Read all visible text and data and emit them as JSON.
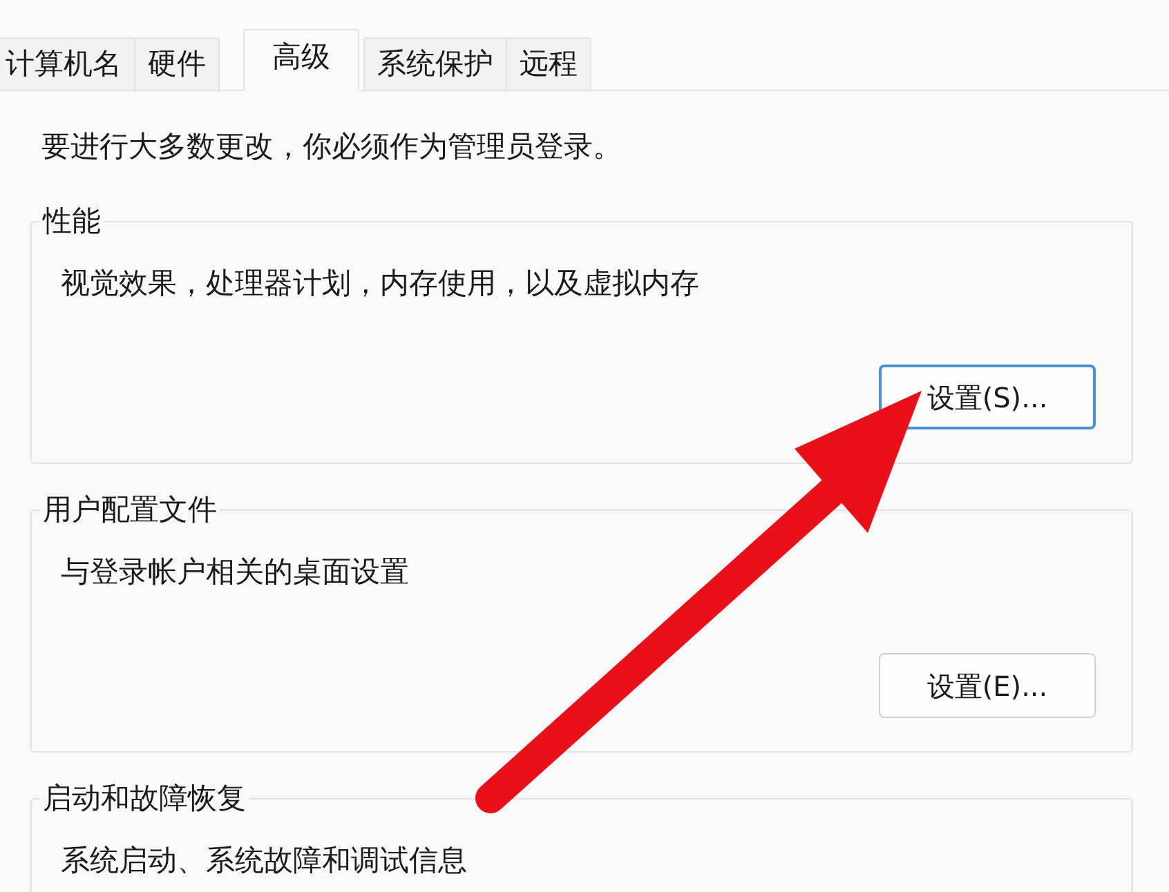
{
  "tabs": [
    {
      "label": "计算机名",
      "selected": false
    },
    {
      "label": "硬件",
      "selected": false
    },
    {
      "label": "高级",
      "selected": true
    },
    {
      "label": "系统保护",
      "selected": false
    },
    {
      "label": "远程",
      "selected": false
    }
  ],
  "notice": "要进行大多数更改，你必须作为管理员登录。",
  "groups": [
    {
      "title": "性能",
      "description": "视觉效果，处理器计划，内存使用，以及虚拟内存",
      "button": {
        "label": "设置(S)...",
        "focused": true
      }
    },
    {
      "title": "用户配置文件",
      "description": "与登录帐户相关的桌面设置",
      "button": {
        "label": "设置(E)...",
        "focused": false
      }
    },
    {
      "title": "启动和故障恢复",
      "description": "系统启动、系统故障和调试信息"
    }
  ],
  "annotations": [
    {
      "kind": "arrow"
    }
  ]
}
